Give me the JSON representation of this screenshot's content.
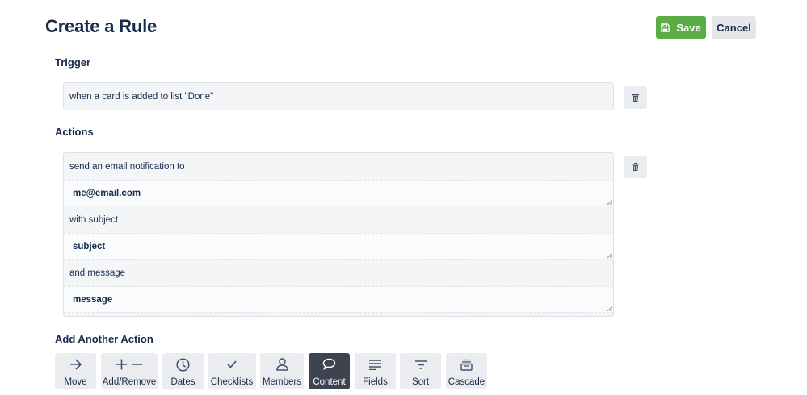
{
  "header": {
    "title": "Create a Rule",
    "save_label": "Save",
    "cancel_label": "Cancel"
  },
  "trigger": {
    "heading": "Trigger",
    "text": "when a card is added to list \"Done\""
  },
  "actions": {
    "heading": "Actions",
    "lines": [
      "send an email notification to",
      "with subject",
      "and message"
    ],
    "fields": [
      "me@email.com",
      "subject",
      "message"
    ]
  },
  "add_action": {
    "heading": "Add Another Action",
    "tools": [
      {
        "label": "Move",
        "icon": "arrow-right-icon"
      },
      {
        "label": "Add/Remove",
        "icon": "plus-minus-icon"
      },
      {
        "label": "Dates",
        "icon": "clock-icon"
      },
      {
        "label": "Checklists",
        "icon": "checkmark-icon"
      },
      {
        "label": "Members",
        "icon": "person-icon"
      },
      {
        "label": "Content",
        "icon": "speech-bubble-icon",
        "active": true
      },
      {
        "label": "Fields",
        "icon": "lines-icon"
      },
      {
        "label": "Sort",
        "icon": "sort-icon"
      },
      {
        "label": "Cascade",
        "icon": "archive-icon"
      }
    ]
  },
  "colors": {
    "save": "#5aac44",
    "active_tool": "#3d4350",
    "text": "#172b4d"
  }
}
